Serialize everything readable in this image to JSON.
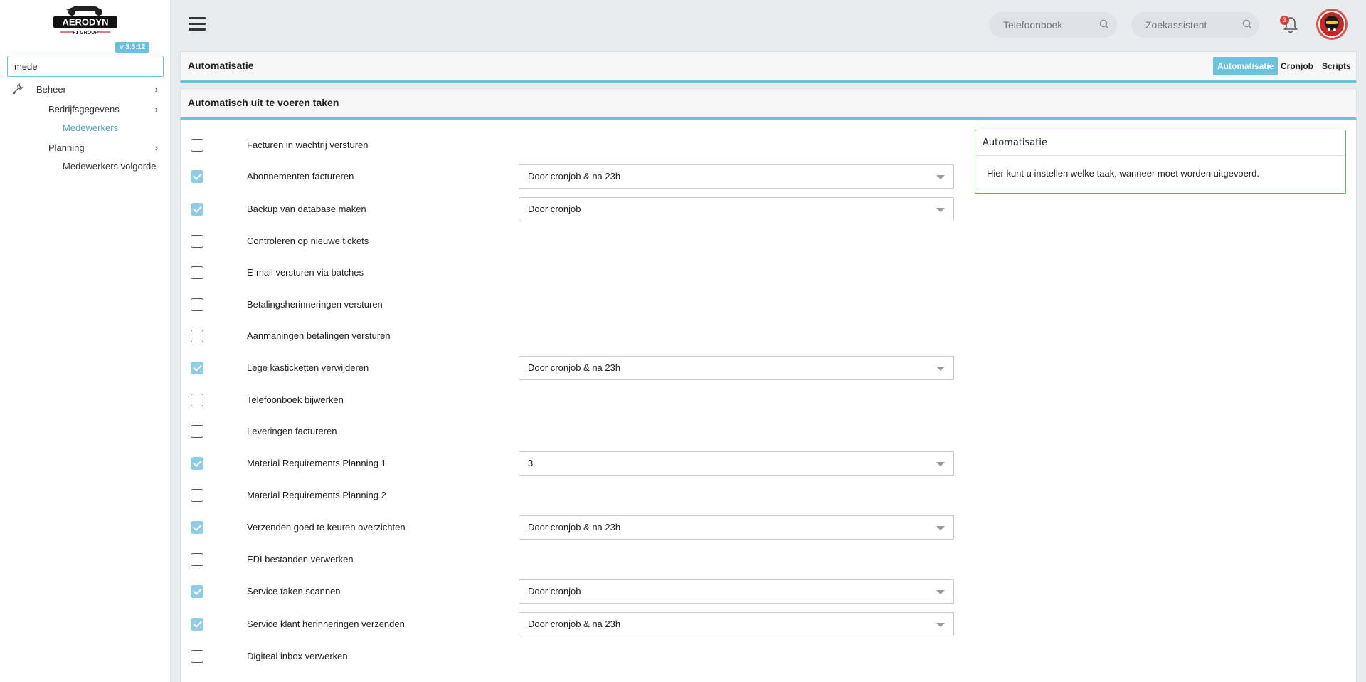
{
  "app": {
    "logo_text": "AERODYN",
    "logo_sub": "F1 GROUP",
    "version": "v 3.3.12"
  },
  "sidebar": {
    "search_value": "mede",
    "items": [
      {
        "label": "Beheer"
      },
      {
        "label": "Bedrijfsgegevens"
      },
      {
        "label": "Medewerkers"
      },
      {
        "label": "Planning"
      },
      {
        "label": "Medewerkers volgorde"
      }
    ]
  },
  "topbar": {
    "phonebook_placeholder": "Telefoonboek",
    "assistant_placeholder": "Zoekassistent",
    "notification_count": "3"
  },
  "header": {
    "title": "Automatisatie",
    "tabs": [
      {
        "label": "Automatisatie",
        "active": true
      },
      {
        "label": "Cronjob",
        "active": false
      },
      {
        "label": "Scripts",
        "active": false
      }
    ]
  },
  "section": {
    "title": "Automatisch uit te voeren taken"
  },
  "tasks": [
    {
      "label": "Facturen in wachtrij versturen",
      "checked": false,
      "select": null
    },
    {
      "label": "Abonnementen factureren",
      "checked": true,
      "select": "Door cronjob & na 23h"
    },
    {
      "label": "Backup van database maken",
      "checked": true,
      "select": "Door cronjob"
    },
    {
      "label": "Controleren op nieuwe tickets",
      "checked": false,
      "select": null
    },
    {
      "label": "E-mail versturen via batches",
      "checked": false,
      "select": null
    },
    {
      "label": "Betalingsherinneringen versturen",
      "checked": false,
      "select": null
    },
    {
      "label": "Aanmaningen betalingen versturen",
      "checked": false,
      "select": null
    },
    {
      "label": "Lege kasticketten verwijderen",
      "checked": true,
      "select": "Door cronjob & na 23h"
    },
    {
      "label": "Telefoonboek bijwerken",
      "checked": false,
      "select": null
    },
    {
      "label": "Leveringen factureren",
      "checked": false,
      "select": null
    },
    {
      "label": "Material Requirements Planning 1",
      "checked": true,
      "select": "3"
    },
    {
      "label": "Material Requirements Planning 2",
      "checked": false,
      "select": null
    },
    {
      "label": "Verzenden goed te keuren overzichten",
      "checked": true,
      "select": "Door cronjob & na 23h"
    },
    {
      "label": "EDI bestanden verwerken",
      "checked": false,
      "select": null
    },
    {
      "label": "Service taken scannen",
      "checked": true,
      "select": "Door cronjob"
    },
    {
      "label": "Service klant herinneringen verzenden",
      "checked": true,
      "select": "Door cronjob & na 23h"
    },
    {
      "label": "Digiteal inbox verwerken",
      "checked": false,
      "select": null
    }
  ],
  "info": {
    "title": "Automatisatie",
    "text": "Hier kunt u instellen welke taak, wanneer moet worden uitgevoerd."
  },
  "colors": {
    "accent": "#6cc1df",
    "checked": "#8fcde4",
    "info_border": "#5cb85c",
    "badge": "#e53935"
  }
}
